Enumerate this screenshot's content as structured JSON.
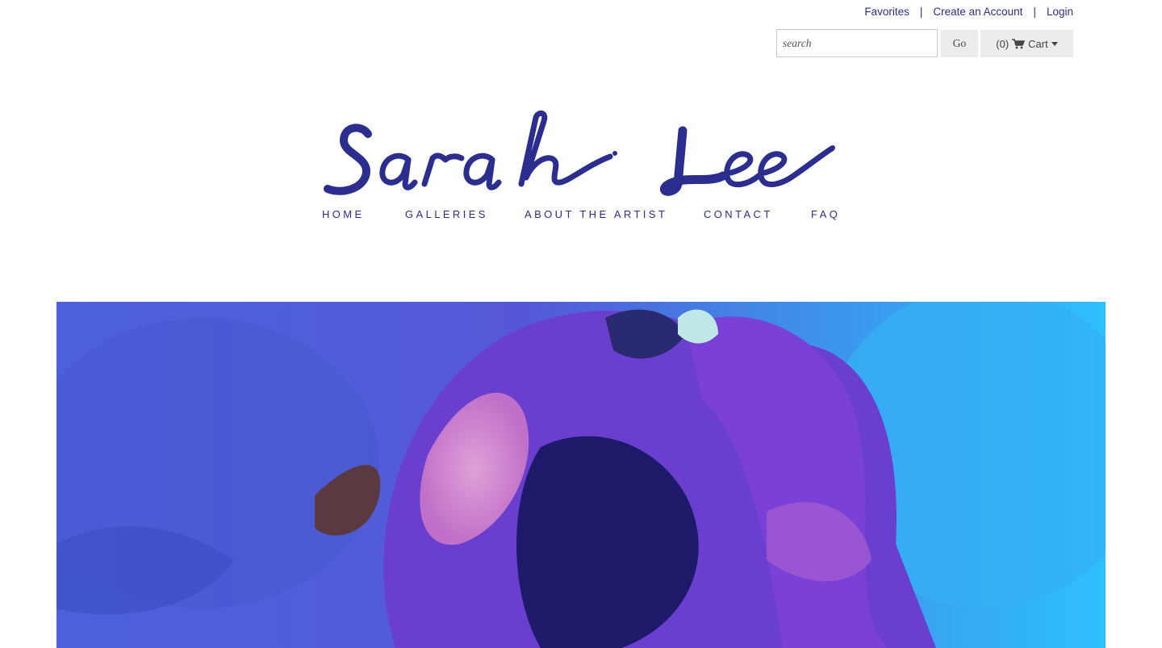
{
  "header": {
    "links": {
      "favorites": "Favorites",
      "create_account": "Create an Account",
      "login": "Login",
      "separator": "|"
    },
    "search": {
      "placeholder": "search",
      "value": ""
    },
    "go_label": "Go",
    "cart": {
      "count": "(0)",
      "label": "Cart",
      "icon": "shopping-cart-icon"
    }
  },
  "logo": {
    "text": "Sarah Lee",
    "color": "#2b2d8f"
  },
  "nav": {
    "items": [
      {
        "label": "HOME"
      },
      {
        "label": "GALLERIES"
      },
      {
        "label": "ABOUT THE ARTIST"
      },
      {
        "label": "CONTACT"
      },
      {
        "label": "FAQ"
      }
    ]
  },
  "colors": {
    "accent": "#2b2d8f",
    "button_bg": "#ececec"
  },
  "hero": {
    "description_icon": "flower-photo"
  }
}
